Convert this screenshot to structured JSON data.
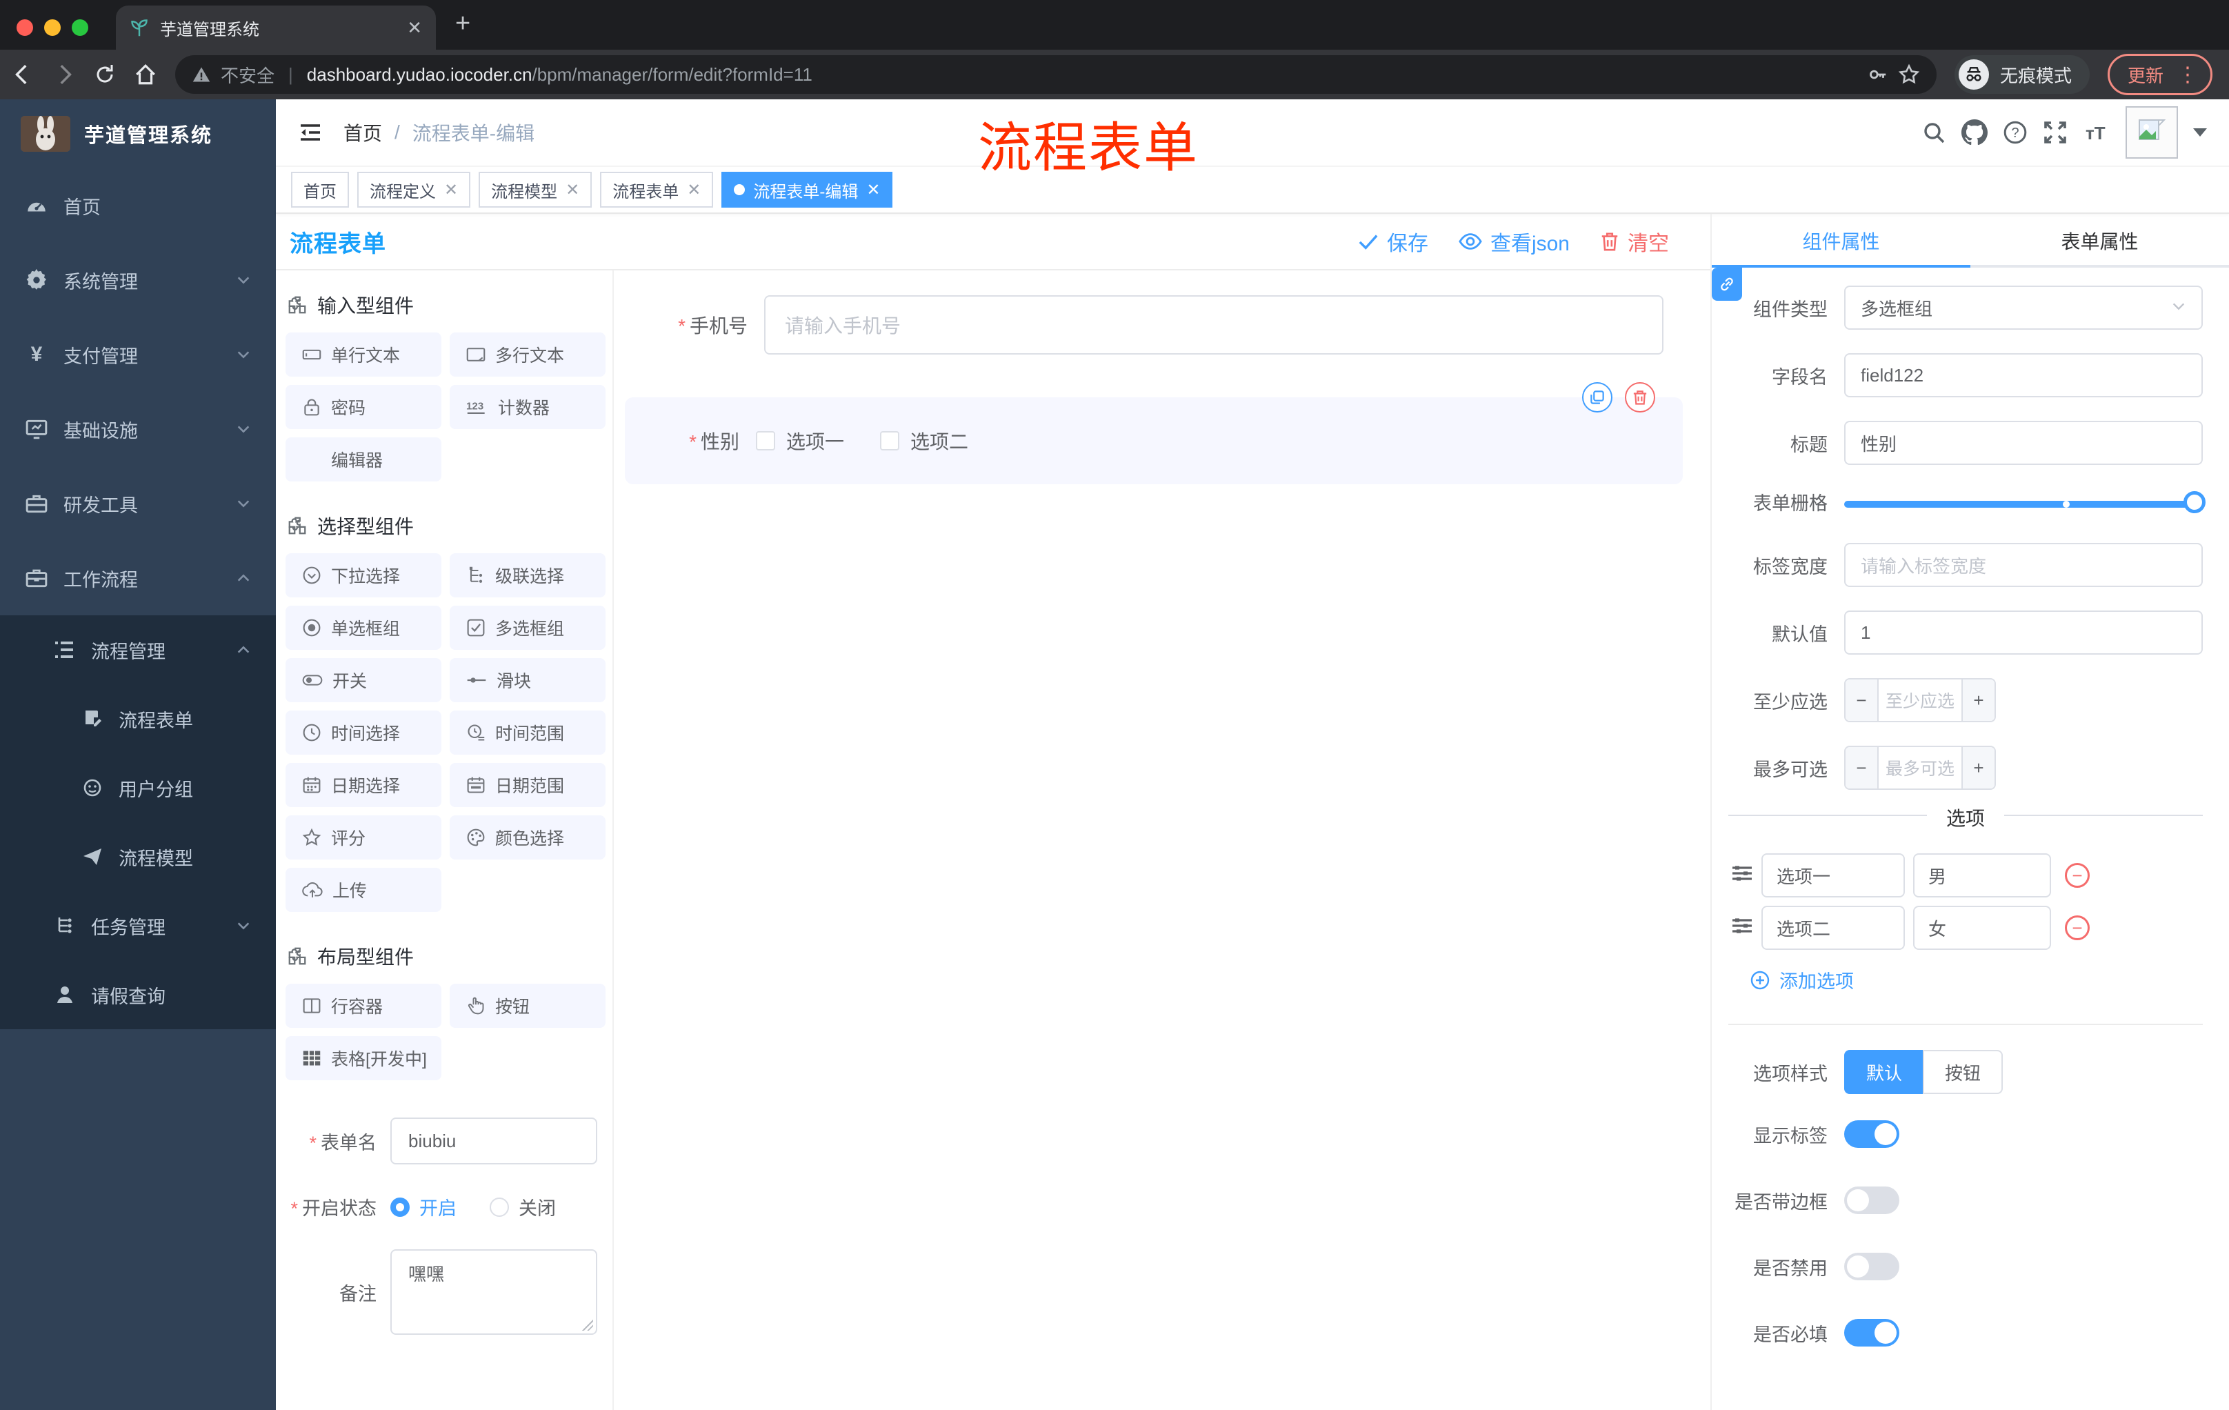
{
  "browser": {
    "tab_title": "芋道管理系统",
    "url_warn": "不安全",
    "url_domain": "dashboard.yudao.iocoder.cn",
    "url_path": "/bpm/manager/form/edit?formId=11",
    "incognito": "无痕模式",
    "update": "更新"
  },
  "header": {
    "breadcrumb_root": "首页",
    "breadcrumb_current": "流程表单-编辑",
    "annotation": "流程表单"
  },
  "tags": {
    "home": "首页",
    "t1": "流程定义",
    "t2": "流程模型",
    "t3": "流程表单",
    "active": "流程表单-编辑"
  },
  "sidebar": {
    "title": "芋道管理系统",
    "items": [
      {
        "label": "首页"
      },
      {
        "label": "系统管理"
      },
      {
        "label": "支付管理"
      },
      {
        "label": "基础设施"
      },
      {
        "label": "研发工具"
      },
      {
        "label": "工作流程"
      }
    ],
    "submenu": [
      {
        "label": "流程管理"
      },
      {
        "label": "流程表单"
      },
      {
        "label": "用户分组"
      },
      {
        "label": "流程模型"
      },
      {
        "label": "任务管理"
      },
      {
        "label": "请假查询"
      }
    ]
  },
  "designer": {
    "title": "流程表单",
    "save": "保存",
    "view_json": "查看json",
    "clear": "清空"
  },
  "components": {
    "sections": [
      {
        "title": "输入型组件",
        "items": [
          "单行文本",
          "多行文本",
          "密码",
          "计数器",
          "编辑器"
        ]
      },
      {
        "title": "选择型组件",
        "items": [
          "下拉选择",
          "级联选择",
          "单选框组",
          "多选框组",
          "开关",
          "滑块",
          "时间选择",
          "时间范围",
          "日期选择",
          "日期范围",
          "评分",
          "颜色选择",
          "上传"
        ]
      },
      {
        "title": "布局型组件",
        "items": [
          "行容器",
          "按钮",
          "表格[开发中]"
        ]
      }
    ]
  },
  "left_form": {
    "name_label": "表单名",
    "name_value": "biubiu",
    "status_label": "开启状态",
    "status_on": "开启",
    "status_off": "关闭",
    "remark_label": "备注",
    "remark_value": "嘿嘿"
  },
  "canvas": {
    "phone_label": "手机号",
    "phone_placeholder": "请输入手机号",
    "gender_label": "性别",
    "gender_opt1": "选项一",
    "gender_opt2": "选项二"
  },
  "props": {
    "tab_component": "组件属性",
    "tab_form": "表单属性",
    "component_type_label": "组件类型",
    "component_type_value": "多选框组",
    "field_label": "字段名",
    "field_value": "field122",
    "title_label": "标题",
    "title_value": "性别",
    "grid_label": "表单栅格",
    "label_width_label": "标签宽度",
    "label_width_placeholder": "请输入标签宽度",
    "default_label": "默认值",
    "default_value": "1",
    "min_label": "至少应选",
    "min_placeholder": "至少应选",
    "max_label": "最多可选",
    "max_placeholder": "最多可选",
    "options_divider": "选项",
    "option1_label": "选项一",
    "option1_value": "男",
    "option2_label": "选项二",
    "option2_value": "女",
    "add_option": "添加选项",
    "style_label": "选项样式",
    "style_default": "默认",
    "style_button": "按钮",
    "toggle_show_label": "显示标签",
    "toggle_border": "是否带边框",
    "toggle_disabled": "是否禁用",
    "toggle_required": "是否必填"
  },
  "colors": {
    "accent": "#409eff",
    "danger": "#f56c6c",
    "annotation_red": "#ff2f00",
    "sidebar_bg": "#304156",
    "submenu_bg": "#1f2d3d"
  }
}
